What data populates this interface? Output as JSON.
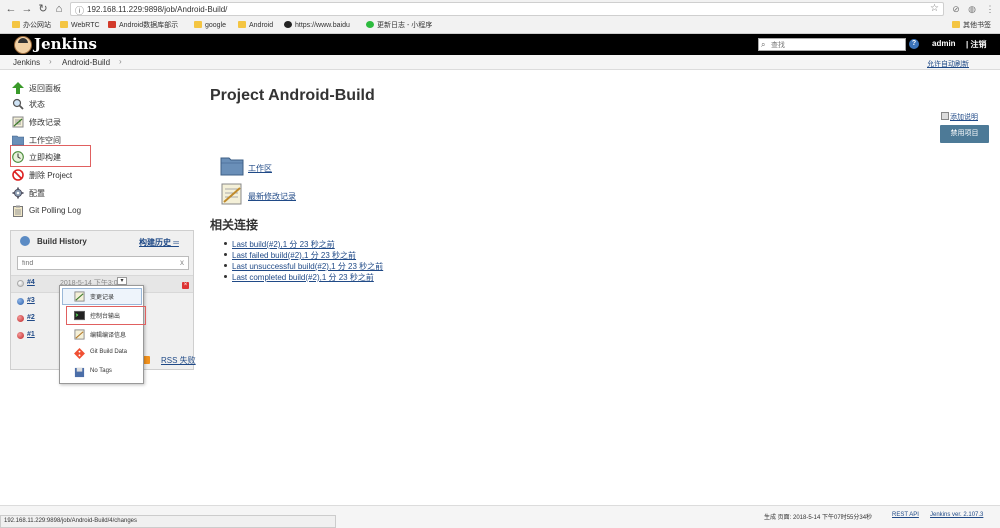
{
  "browser": {
    "url": "192.168.11.229:9898/job/Android-Build/",
    "bookmarks": [
      {
        "label": "办公网站",
        "icon": "folder-icon"
      },
      {
        "label": "WebRTC",
        "icon": "folder-icon"
      },
      {
        "label": "Android数据库部示",
        "icon": "csdn-icon"
      },
      {
        "label": "google",
        "icon": "folder-icon"
      },
      {
        "label": "Android",
        "icon": "folder-icon"
      },
      {
        "label": "https://www.baidu",
        "icon": "github-icon"
      },
      {
        "label": "更新日志 - 小程序",
        "icon": "wechat-icon"
      }
    ],
    "other_bookmarks": "其他书签",
    "status_url": "192.168.11.229:9898/job/Android-Build/4/changes"
  },
  "header": {
    "brand": "Jenkins",
    "search_placeholder": "查找",
    "help": "?",
    "user": "admin",
    "logout": "| 注销"
  },
  "breadcrumb": {
    "items": [
      "Jenkins",
      "Android-Build"
    ],
    "auto_refresh": "允许自动刷新"
  },
  "sidebar": {
    "tasks": [
      {
        "label": "返回面板",
        "icon": "up-arrow-icon"
      },
      {
        "label": "状态",
        "icon": "magnifier-icon"
      },
      {
        "label": "修改记录",
        "icon": "notepad-icon"
      },
      {
        "label": "工作空间",
        "icon": "folder-icon"
      },
      {
        "label": "立即构建",
        "icon": "clock-icon"
      },
      {
        "label": "删除 Project",
        "icon": "no-entry-icon"
      },
      {
        "label": "配置",
        "icon": "gear-icon"
      },
      {
        "label": "Git Polling Log",
        "icon": "clipboard-icon"
      }
    ]
  },
  "build_history": {
    "title": "Build History",
    "trend": "构建历史 ═",
    "find_placeholder": "find",
    "clear": "x",
    "builds": [
      {
        "number": "#4",
        "status": "pending",
        "date": "2018-5-14 下午3:03"
      },
      {
        "number": "#3",
        "status": "blue"
      },
      {
        "number": "#2",
        "status": "red"
      },
      {
        "number": "#1",
        "status": "red"
      }
    ],
    "dropdown": "▾",
    "rss": "RSS 失败"
  },
  "context_menu": {
    "items": [
      {
        "label": "变更记录",
        "icon": "notepad-icon"
      },
      {
        "label": "控制台输出",
        "icon": "terminal-icon"
      },
      {
        "label": "编辑编译信息",
        "icon": "notepad-edit-icon"
      },
      {
        "label": "Git Build Data",
        "icon": "git-icon"
      },
      {
        "label": "No Tags",
        "icon": "floppy-icon"
      }
    ]
  },
  "main": {
    "title": "Project Android-Build",
    "add_description": "添加说明",
    "disable_project": "禁用项目",
    "items": [
      {
        "label": "工作区",
        "icon": "folder-icon"
      },
      {
        "label": "最新修改记录",
        "icon": "notepad-icon"
      }
    ],
    "related_heading": "相关连接",
    "related_links": [
      "Last build(#2),1 分 23 秒之前",
      "Last failed build(#2),1 分 23 秒之前",
      "Last unsuccessful build(#2),1 分 23 秒之前",
      "Last completed build(#2),1 分 23 秒之前"
    ]
  },
  "footer": {
    "generated": "生成 页面: 2018-5-14 下午07时55分34秒",
    "rest_api": "REST API",
    "version": "Jenkins ver. 2.107.3"
  },
  "colors": {
    "header_bg": "#000000",
    "link": "#204a87",
    "button_bg": "#4d7a97",
    "highlight_border": "#e06060"
  }
}
